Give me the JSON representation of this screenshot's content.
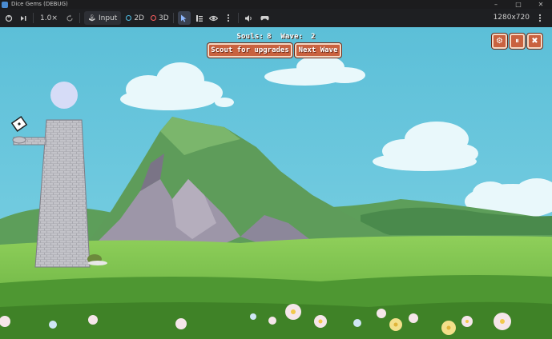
{
  "window": {
    "title": "Dice Gems (DEBUG)",
    "controls": {
      "minimize": "–",
      "maximize": "□",
      "close": "✕"
    }
  },
  "toolbar": {
    "zoom": "1.0×",
    "input_label": "Input",
    "mode_2d_label": "2D",
    "mode_3d_label": "3D",
    "resolution": "1280x720",
    "colors": {
      "2d_dot": "#4fc1e9",
      "3d_dot": "#ff5f5f",
      "active": "#8fb8ff"
    },
    "icons": [
      "suspend-icon",
      "step-frame-icon",
      "reset-speed-icon",
      "input-icon",
      "select-icon",
      "list-icon",
      "eye-icon",
      "kebab-menu-icon",
      "speaker-icon",
      "controller-icon",
      "kebab-menu-icon"
    ]
  },
  "game": {
    "souls_label": "Souls:",
    "souls_value": "8",
    "wave_label": "Wave:",
    "wave_value": "2",
    "scout_button": "Scout for upgrades",
    "next_wave_button": "Next Wave",
    "top_right_icons": [
      "gear-icon",
      "pause-icon",
      "close-icon"
    ],
    "colors": {
      "button_fill": "#c9623f",
      "button_border": "#f4d8c4",
      "sky": "#5fc0d8"
    }
  }
}
